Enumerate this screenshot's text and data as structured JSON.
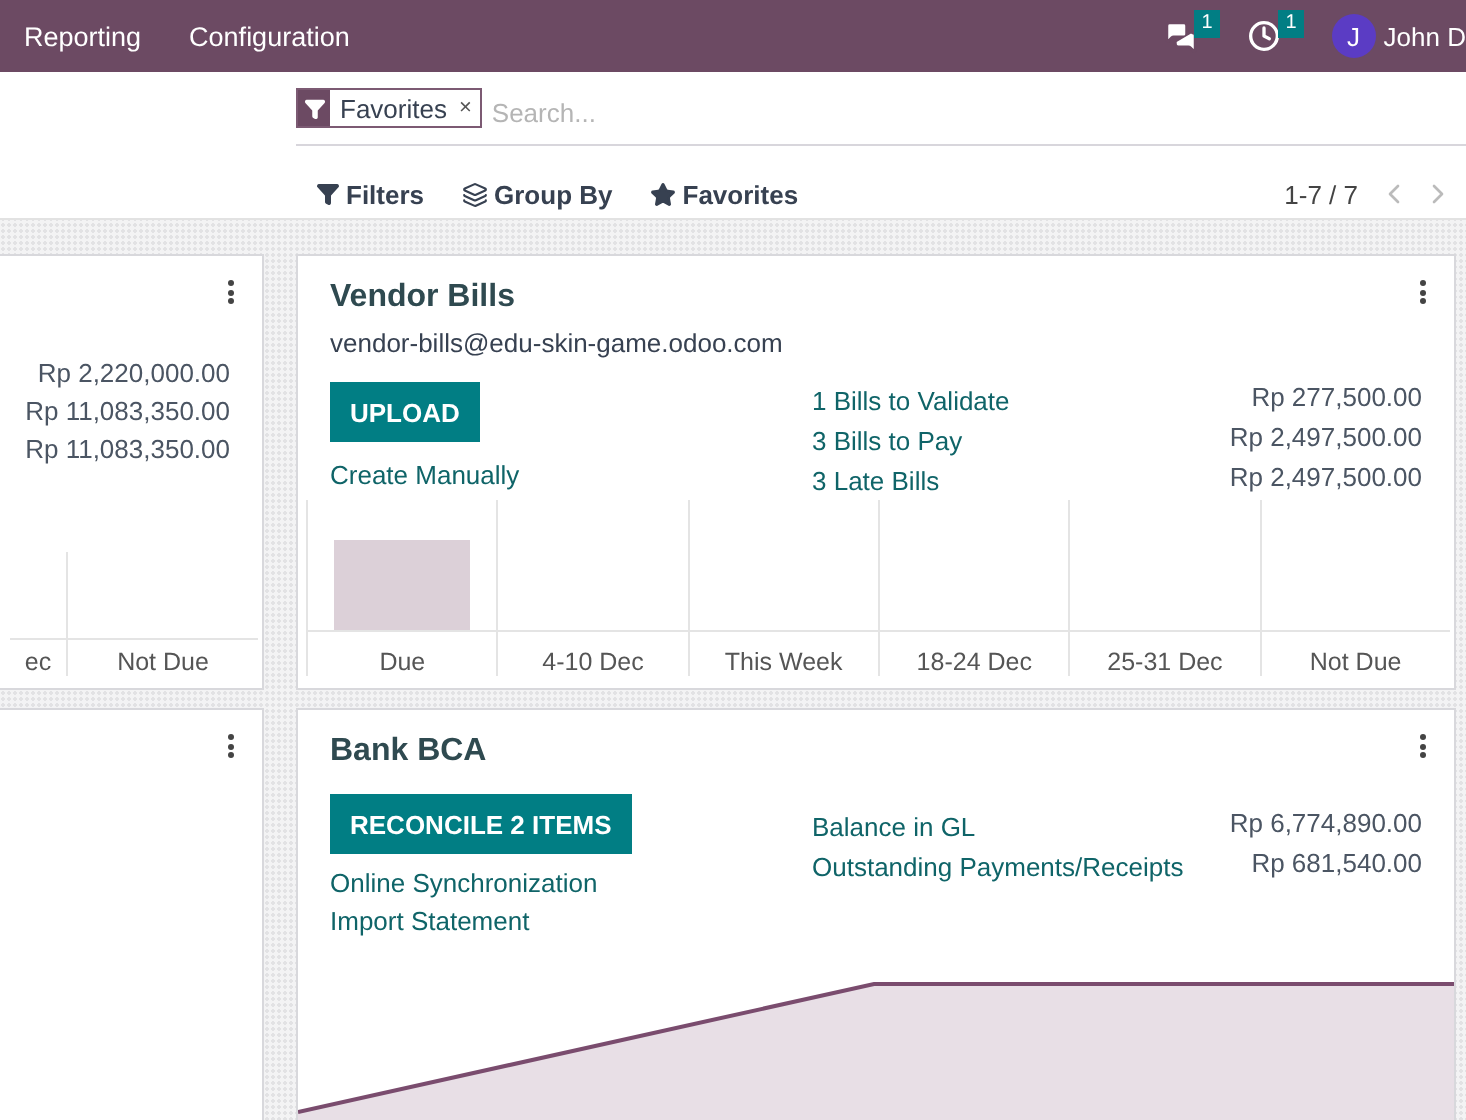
{
  "top_menu": [
    "Reporting",
    "Configuration"
  ],
  "systray": {
    "messages_count": "1",
    "activities_count": "1",
    "avatar_initial": "J",
    "user_name": "John D"
  },
  "search": {
    "facet": "Favorites",
    "facet_remove": "×",
    "placeholder": "Search..."
  },
  "filters": [
    "Filters",
    "Group By",
    "Favorites"
  ],
  "pager": "1-7 / 7",
  "left_card_top": {
    "amounts": [
      "Rp 2,220,000.00",
      "Rp 11,083,350.00",
      "Rp 11,083,350.00"
    ],
    "chart_labels": [
      "ec",
      "Not Due"
    ]
  },
  "vendor_bills": {
    "title": "Vendor Bills",
    "email": "vendor-bills@edu-skin-game.odoo.com",
    "button": "UPLOAD",
    "link": "Create Manually",
    "stats": [
      {
        "label": "1 Bills to Validate",
        "amount": "Rp 277,500.00"
      },
      {
        "label": "3 Bills to Pay",
        "amount": "Rp 2,497,500.00"
      },
      {
        "label": "3 Late Bills",
        "amount": "Rp 2,497,500.00"
      }
    ],
    "chart_labels": [
      "Due",
      "4-10 Dec",
      "This Week",
      "18-24 Dec",
      "25-31 Dec",
      "Not Due"
    ]
  },
  "bank": {
    "title": "Bank BCA",
    "button": "RECONCILE 2 ITEMS",
    "links": [
      "Online Synchronization",
      "Import Statement"
    ],
    "stats": [
      {
        "label": "Balance in GL",
        "amount": "Rp 6,774,890.00"
      },
      {
        "label": "Outstanding Payments/Receipts",
        "amount": "Rp 681,540.00"
      }
    ]
  }
}
